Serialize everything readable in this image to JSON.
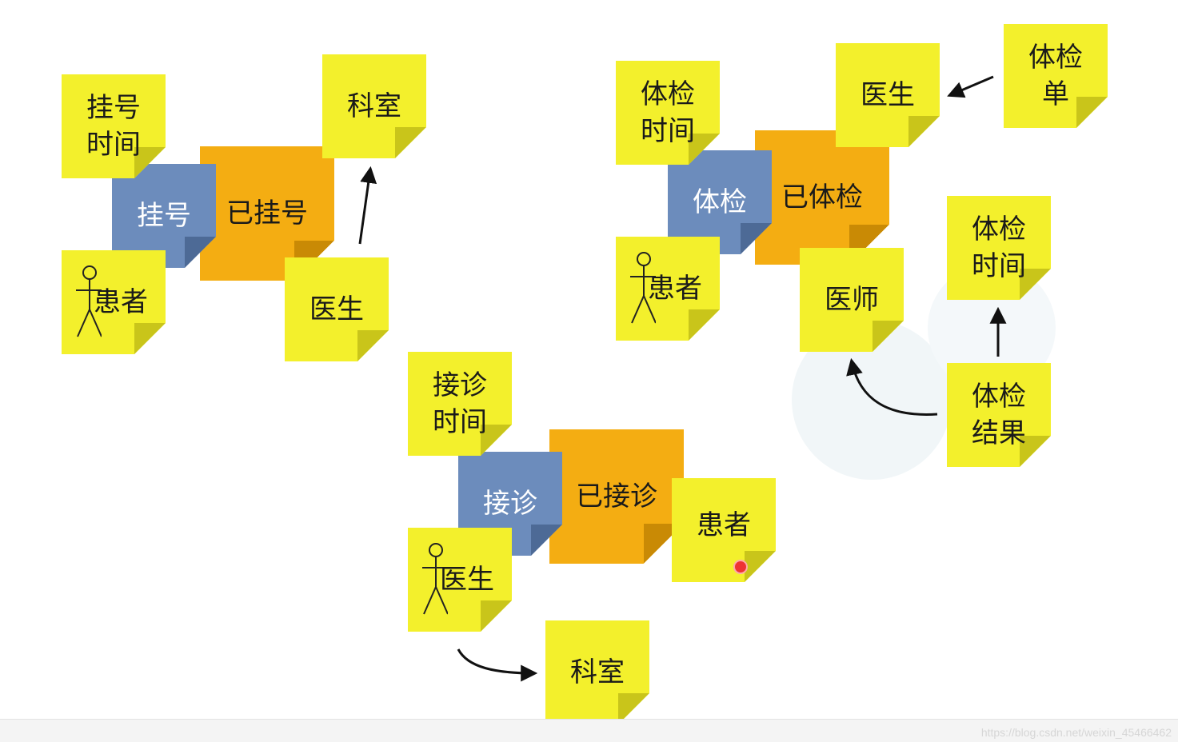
{
  "group1": {
    "register_time": "挂号\n时间",
    "register": "挂号",
    "registered": "已挂号",
    "department": "科室",
    "patient": "患者",
    "doctor": "医生"
  },
  "group2": {
    "exam_time": "体检\n时间",
    "doctor": "医生",
    "exam_form": "体检\n单",
    "exam": "体检",
    "examined": "已体检",
    "patient": "患者",
    "physician": "医师",
    "exam_time2": "体检\n时间",
    "exam_result": "体检\n结果"
  },
  "group3": {
    "consult_time": "接诊\n时间",
    "consult": "接诊",
    "consulted": "已接诊",
    "patient": "患者",
    "doctor": "医生",
    "department": "科室"
  },
  "footer": {
    "watermark": "https://blog.csdn.net/weixin_45466462"
  }
}
